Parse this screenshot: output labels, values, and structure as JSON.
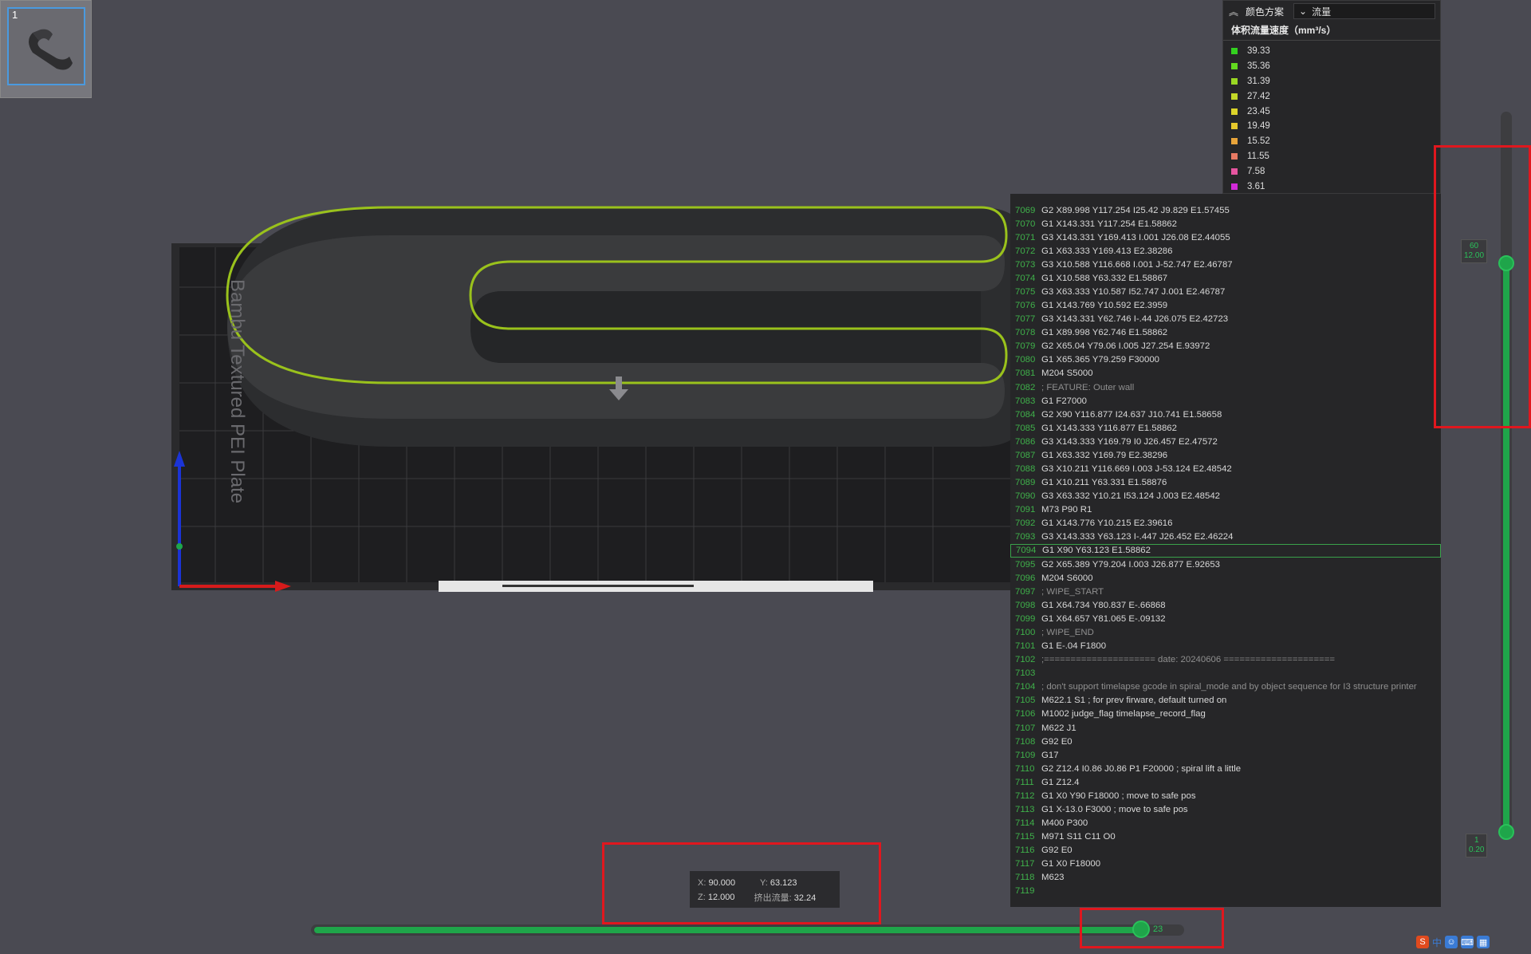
{
  "plate": {
    "index": "1"
  },
  "legend": {
    "scheme_label": "颜色方案",
    "scheme_value": "流量",
    "subtitle": "体积流量速度（mm³/s）",
    "items": [
      {
        "value": "39.33",
        "color": "#33d11f"
      },
      {
        "value": "35.36",
        "color": "#63d91f"
      },
      {
        "value": "31.39",
        "color": "#9ad823"
      },
      {
        "value": "27.42",
        "color": "#c3d828"
      },
      {
        "value": "23.45",
        "color": "#dcd42a"
      },
      {
        "value": "19.49",
        "color": "#e6c82c"
      },
      {
        "value": "15.52",
        "color": "#e8a43a"
      },
      {
        "value": "11.55",
        "color": "#e87a64"
      },
      {
        "value": "7.58",
        "color": "#e655a0"
      },
      {
        "value": "3.61",
        "color": "#d22ad8"
      }
    ]
  },
  "gcode": [
    {
      "n": "7069",
      "t": "G2 X89.998 Y117.254 I25.42 J9.829 E1.57455"
    },
    {
      "n": "7070",
      "t": "G1 X143.331 Y117.254 E1.58862"
    },
    {
      "n": "7071",
      "t": "G3 X143.331 Y169.413 I.001 J26.08 E2.44055"
    },
    {
      "n": "7072",
      "t": "G1 X63.333 Y169.413 E2.38286"
    },
    {
      "n": "7073",
      "t": "G3 X10.588 Y116.668 I.001 J-52.747 E2.46787"
    },
    {
      "n": "7074",
      "t": "G1 X10.588 Y63.332 E1.58867"
    },
    {
      "n": "7075",
      "t": "G3 X63.333 Y10.587 I52.747 J.001 E2.46787"
    },
    {
      "n": "7076",
      "t": "G1 X143.769 Y10.592 E2.3959"
    },
    {
      "n": "7077",
      "t": "G3 X143.331 Y62.746 I-.44 J26.075 E2.42723"
    },
    {
      "n": "7078",
      "t": "G1 X89.998 Y62.746 E1.58862"
    },
    {
      "n": "7079",
      "t": "G2 X65.04 Y79.06 I.005 J27.254 E.93972"
    },
    {
      "n": "7080",
      "t": "G1 X65.365 Y79.259 F30000"
    },
    {
      "n": "7081",
      "t": "M204 S5000"
    },
    {
      "n": "7082",
      "t": "; FEATURE: Outer wall",
      "c": true
    },
    {
      "n": "7083",
      "t": "G1 F27000"
    },
    {
      "n": "7084",
      "t": "G2 X90 Y116.877 I24.637 J10.741 E1.58658"
    },
    {
      "n": "7085",
      "t": "G1 X143.333 Y116.877 E1.58862"
    },
    {
      "n": "7086",
      "t": "G3 X143.333 Y169.79 I0 J26.457 E2.47572"
    },
    {
      "n": "7087",
      "t": "G1 X63.332 Y169.79 E2.38296"
    },
    {
      "n": "7088",
      "t": "G3 X10.211 Y116.669 I.003 J-53.124 E2.48542"
    },
    {
      "n": "7089",
      "t": "G1 X10.211 Y63.331 E1.58876"
    },
    {
      "n": "7090",
      "t": "G3 X63.332 Y10.21 I53.124 J.003 E2.48542"
    },
    {
      "n": "7091",
      "t": "M73 P90 R1"
    },
    {
      "n": "7092",
      "t": "G1 X143.776 Y10.215 E2.39616"
    },
    {
      "n": "7093",
      "t": "G3 X143.333 Y63.123 I-.447 J26.452 E2.46224"
    },
    {
      "n": "7094",
      "t": "G1 X90 Y63.123 E1.58862",
      "active": true
    },
    {
      "n": "7095",
      "t": "G2 X65.389 Y79.204 I.003 J26.877 E.92653"
    },
    {
      "n": "7096",
      "t": "M204 S6000"
    },
    {
      "n": "7097",
      "t": "; WIPE_START",
      "c": true
    },
    {
      "n": "7098",
      "t": "G1 X64.734 Y80.837 E-.66868"
    },
    {
      "n": "7099",
      "t": "G1 X64.657 Y81.065 E-.09132"
    },
    {
      "n": "7100",
      "t": "; WIPE_END",
      "c": true
    },
    {
      "n": "7101",
      "t": "G1 E-.04 F1800"
    },
    {
      "n": "7102",
      "t": ";===================== date: 20240606 =====================",
      "c": true
    },
    {
      "n": "7103",
      "t": ""
    },
    {
      "n": "7104",
      "t": "; don't support timelapse gcode in spiral_mode and by object sequence for I3 structure printer",
      "c": true
    },
    {
      "n": "7105",
      "t": "M622.1 S1 ; for prev firware, default turned on"
    },
    {
      "n": "7106",
      "t": "M1002 judge_flag timelapse_record_flag"
    },
    {
      "n": "7107",
      "t": "M622 J1"
    },
    {
      "n": "7108",
      "t": "G92 E0"
    },
    {
      "n": "7109",
      "t": "G17"
    },
    {
      "n": "7110",
      "t": "G2 Z12.4 I0.86 J0.86 P1 F20000 ; spiral lift a little"
    },
    {
      "n": "7111",
      "t": "G1 Z12.4"
    },
    {
      "n": "7112",
      "t": "G1 X0 Y90 F18000 ; move to safe pos"
    },
    {
      "n": "7113",
      "t": "G1 X-13.0 F3000 ; move to safe pos"
    },
    {
      "n": "7114",
      "t": "M400 P300"
    },
    {
      "n": "7115",
      "t": "M971 S11 C11 O0"
    },
    {
      "n": "7116",
      "t": "G92 E0"
    },
    {
      "n": "7117",
      "t": "G1 X0 F18000"
    },
    {
      "n": "7118",
      "t": "M623"
    },
    {
      "n": "7119",
      "t": ""
    }
  ],
  "vslider": {
    "top_label_1": "60",
    "top_label_2": "12.00",
    "bottom_label_1": "1",
    "bottom_label_2": "0.20"
  },
  "hslider": {
    "value": "23"
  },
  "info": {
    "x_label": "X:",
    "x_value": "90.000",
    "y_label": "Y:",
    "y_value": "63.123",
    "z_label": "Z:",
    "z_value": "12.000",
    "flow_label": "挤出流量:",
    "flow_value": "32.24"
  },
  "bed": {
    "text": "Bambu Textured PEI Plate"
  },
  "tray": {
    "ime": "中"
  }
}
